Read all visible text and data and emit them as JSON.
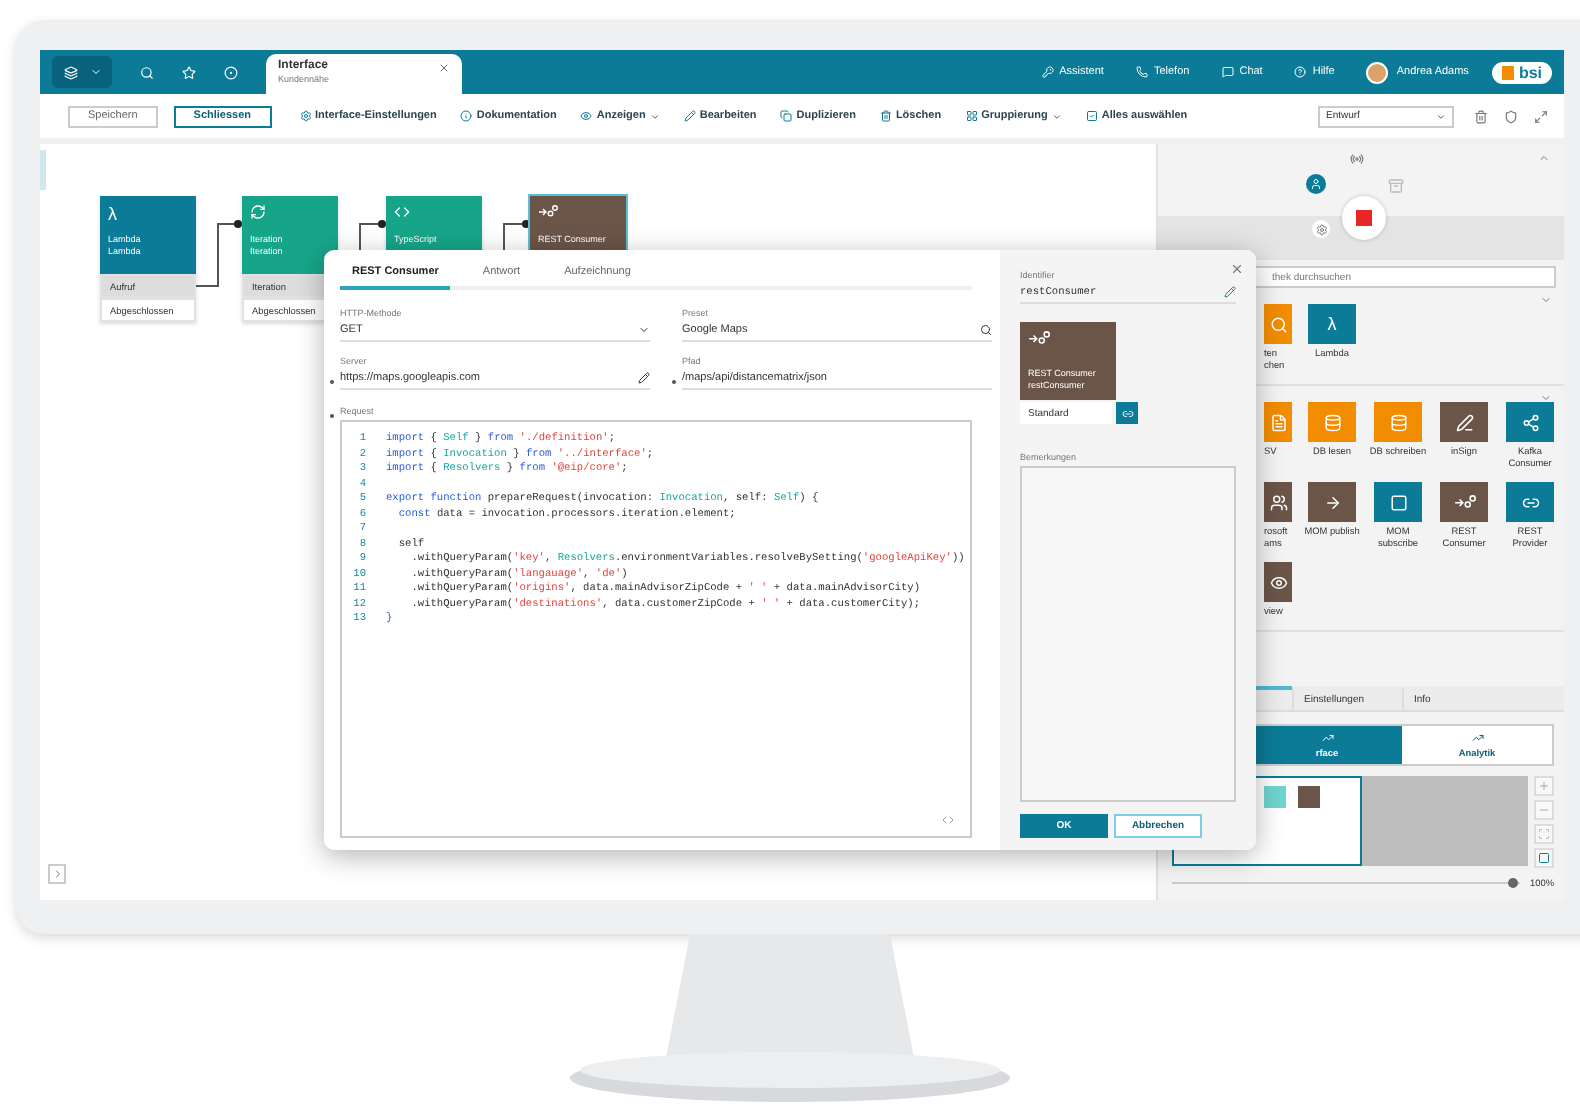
{
  "topbar": {
    "tab": {
      "title": "Interface",
      "subtitle": "Kundennähe"
    },
    "links": [
      {
        "kind": "key",
        "label": "Assistent"
      },
      {
        "kind": "phone",
        "label": "Telefon"
      },
      {
        "kind": "chat",
        "label": "Chat"
      },
      {
        "kind": "help",
        "label": "Hilfe"
      }
    ],
    "user": {
      "name": "Andrea Adams"
    },
    "logo": "bsi"
  },
  "toolbar": {
    "buttons": [
      {
        "kind": "plain",
        "label": "Speichern"
      },
      {
        "kind": "outlined",
        "label": "Schliessen"
      }
    ],
    "actions": [
      {
        "kind": "gear",
        "label": "Interface-Einstellungen",
        "dropdown": false
      },
      {
        "kind": "info",
        "label": "Dokumentation",
        "dropdown": false
      },
      {
        "kind": "eye",
        "label": "Anzeigen",
        "dropdown": true
      },
      {
        "kind": "pencil",
        "label": "Bearbeiten",
        "dropdown": false
      },
      {
        "kind": "copy",
        "label": "Duplizieren",
        "dropdown": false
      },
      {
        "kind": "trash",
        "label": "Löschen",
        "dropdown": false
      },
      {
        "kind": "group",
        "label": "Gruppierung",
        "dropdown": true
      },
      {
        "kind": "select-all",
        "label": "Alles auswählen",
        "dropdown": false
      }
    ],
    "status": "Entwurf"
  },
  "canvas": {
    "nodes": [
      {
        "kind": "lambda",
        "icon_char": "λ",
        "color": "#0b7b98",
        "title": "Lambda",
        "subtitle": "Lambda",
        "rows": [
          "Aufruf",
          "Abgeschlossen"
        ],
        "selected": false
      },
      {
        "kind": "iteration",
        "color": "#17a589",
        "title": "Iteration",
        "subtitle": "Iteration",
        "rows": [
          "Iteration",
          "Abgeschlossen"
        ],
        "selected": false
      },
      {
        "kind": "script",
        "color": "#17a589",
        "title": "TypeScript",
        "selected": false
      },
      {
        "kind": "rest",
        "color": "#6b5548",
        "title": "REST Consumer",
        "selected": true
      }
    ]
  },
  "dialog": {
    "tabs": [
      {
        "label": "REST Consumer",
        "selected": true
      },
      {
        "label": "Antwort",
        "selected": false
      },
      {
        "label": "Aufzeichnung",
        "selected": false
      }
    ],
    "fields": [
      {
        "kind": "select",
        "label": "HTTP-Methode",
        "value": "GET",
        "required": false
      },
      {
        "kind": "search",
        "label": "Preset",
        "value": "Google Maps",
        "required": false
      },
      {
        "kind": "edit",
        "label": "Server",
        "value": "https://maps.googleapis.com",
        "required": true
      },
      {
        "kind": "text",
        "label": "Pfad",
        "value": "/maps/api/distancematrix/json",
        "required": true
      }
    ],
    "request": {
      "label": "Request",
      "required": true,
      "lines": [
        {
          "number": "1",
          "tokens": [
            {
              "kind": "keyword",
              "text": "import"
            },
            {
              "kind": "plain",
              "text": " { "
            },
            {
              "kind": "type",
              "text": "Self"
            },
            {
              "kind": "plain",
              "text": " } "
            },
            {
              "kind": "keyword",
              "text": "from "
            },
            {
              "kind": "string",
              "text": "'./definition'"
            },
            {
              "kind": "plain",
              "text": ";"
            }
          ]
        },
        {
          "number": "2",
          "tokens": [
            {
              "kind": "keyword",
              "text": "import"
            },
            {
              "kind": "plain",
              "text": " { "
            },
            {
              "kind": "type",
              "text": "Invocation"
            },
            {
              "kind": "plain",
              "text": " } "
            },
            {
              "kind": "keyword",
              "text": "from "
            },
            {
              "kind": "string",
              "text": "'../interface'"
            },
            {
              "kind": "plain",
              "text": ";"
            }
          ]
        },
        {
          "number": "3",
          "tokens": [
            {
              "kind": "keyword",
              "text": "import"
            },
            {
              "kind": "plain",
              "text": " { "
            },
            {
              "kind": "type",
              "text": "Resolvers"
            },
            {
              "kind": "plain",
              "text": " } "
            },
            {
              "kind": "keyword",
              "text": "from "
            },
            {
              "kind": "string",
              "text": "'@eip/core'"
            },
            {
              "kind": "plain",
              "text": ";"
            }
          ]
        },
        {
          "number": "4"
        },
        {
          "number": "5",
          "tokens": [
            {
              "kind": "keyword",
              "text": "export function"
            },
            {
              "kind": "plain",
              "text": " prepareRequest(invocation: "
            },
            {
              "kind": "type",
              "text": "Invocation"
            },
            {
              "kind": "plain",
              "text": ", self: "
            },
            {
              "kind": "type",
              "text": "Self"
            },
            {
              "kind": "plain",
              "text": ") {"
            }
          ]
        },
        {
          "number": "6",
          "tokens": [
            {
              "kind": "keyword",
              "text": "  const"
            },
            {
              "kind": "plain",
              "text": " data = invocation.processors.iteration.element;"
            }
          ]
        },
        {
          "number": "7"
        },
        {
          "number": "8",
          "tokens": [
            {
              "kind": "plain",
              "text": "  self"
            }
          ]
        },
        {
          "number": "9",
          "tokens": [
            {
              "kind": "plain",
              "text": "    .withQueryParam("
            },
            {
              "kind": "string",
              "text": "'key'"
            },
            {
              "kind": "plain",
              "text": ", "
            },
            {
              "kind": "type",
              "text": "Resolvers"
            },
            {
              "kind": "plain",
              "text": ".environmentVariables.resolveBySetting("
            },
            {
              "kind": "string",
              "text": "'googleApiKey'"
            },
            {
              "kind": "plain",
              "text": "))"
            }
          ]
        },
        {
          "number": "10",
          "tokens": [
            {
              "kind": "plain",
              "text": "    .withQueryParam("
            },
            {
              "kind": "string",
              "text": "'langauage'"
            },
            {
              "kind": "plain",
              "text": ", "
            },
            {
              "kind": "string",
              "text": "'de'"
            },
            {
              "kind": "plain",
              "text": ")"
            }
          ]
        },
        {
          "number": "11",
          "tokens": [
            {
              "kind": "plain",
              "text": "    .withQueryParam("
            },
            {
              "kind": "string",
              "text": "'origins'"
            },
            {
              "kind": "plain",
              "text": ", data.mainAdvisorZipCode + "
            },
            {
              "kind": "string",
              "text": "' '"
            },
            {
              "kind": "plain",
              "text": " + data.mainAdvisorCity)"
            }
          ]
        },
        {
          "number": "12",
          "tokens": [
            {
              "kind": "plain",
              "text": "    .withQueryParam("
            },
            {
              "kind": "string",
              "text": "'destinations'"
            },
            {
              "kind": "plain",
              "text": ", data.customerZipCode + "
            },
            {
              "kind": "string",
              "text": "' '"
            },
            {
              "kind": "plain",
              "text": " + data.customerCity);"
            }
          ]
        },
        {
          "number": "13",
          "tokens": [
            {
              "kind": "keyword",
              "text": "}"
            }
          ]
        }
      ]
    },
    "side": {
      "identifier_label": "Identifier",
      "identifier": "restConsumer",
      "tile": {
        "title": "REST Consumer",
        "subtitle": "restConsumer"
      },
      "variant": "Standard",
      "remarks_label": "Bemerkungen"
    },
    "buttons": [
      {
        "kind": "primary",
        "label": "OK"
      },
      {
        "kind": "secondary",
        "label": "Abbrechen"
      }
    ]
  },
  "palette": {
    "search_placeholder": "thek durchsuchen",
    "sections": [
      {
        "expanded": true,
        "items": [
          {
            "kind": "search",
            "partial": true,
            "color": "#f28c00",
            "label": "ten chen"
          },
          {
            "kind": "lambda",
            "partial": false,
            "icon_char": "λ",
            "color": "#0b7b98",
            "label": "Lambda"
          }
        ]
      },
      {
        "expanded": true,
        "items": [
          {
            "kind": "file",
            "partial": true,
            "color": "#f28c00",
            "label": "SV"
          },
          {
            "kind": "db-read",
            "partial": false,
            "color": "#f28c00",
            "label": "DB lesen"
          },
          {
            "kind": "db-write",
            "partial": false,
            "color": "#f28c00",
            "label": "DB schreiben"
          },
          {
            "kind": "sign",
            "partial": false,
            "color": "#6b5548",
            "label": "inSign"
          },
          {
            "kind": "stream",
            "partial": false,
            "color": "#0b7b98",
            "label": "Kafka Consumer"
          },
          {
            "kind": "people",
            "partial": true,
            "color": "#6b5548",
            "label": "rosoft ams"
          },
          {
            "kind": "publish",
            "partial": false,
            "color": "#6b5548",
            "label": "MOM publish"
          },
          {
            "kind": "subscribe",
            "partial": false,
            "color": "#0b7b98",
            "label": "MOM subscribe"
          },
          {
            "kind": "rest-in",
            "partial": false,
            "color": "#6b5548",
            "label": "REST Consumer"
          },
          {
            "kind": "rest-out",
            "partial": false,
            "color": "#0b7b98",
            "label": "REST Provider"
          },
          {
            "kind": "eye",
            "partial": true,
            "color": "#6b5548",
            "label": "view"
          }
        ]
      }
    ]
  },
  "bottom_tabs": [
    {
      "selected": true
    },
    {
      "label": "Einstellungen",
      "selected": false
    },
    {
      "label": "Info",
      "selected": false
    }
  ],
  "view_toggle": [
    {
      "label": "rface",
      "selected": true
    },
    {
      "label": "Analytik",
      "selected": false
    }
  ],
  "zoom": {
    "level": 0.98,
    "reading": "100%"
  }
}
